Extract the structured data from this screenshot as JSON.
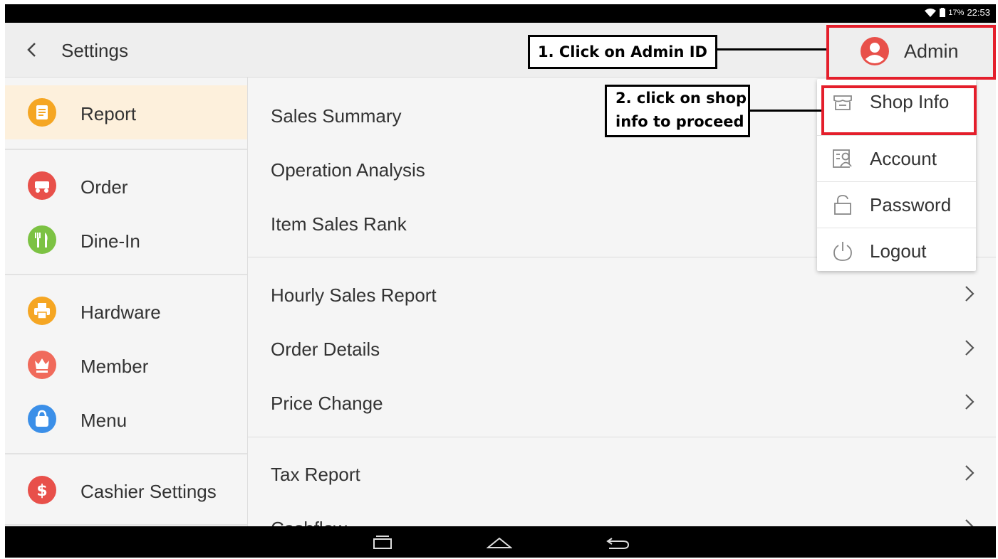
{
  "status_bar": {
    "battery": "17%",
    "time": "22:53"
  },
  "header": {
    "title": "Settings",
    "user": "Admin"
  },
  "sidebar": {
    "items": [
      {
        "label": "Report",
        "icon": "report-icon",
        "color": "#f5a623",
        "active": true
      },
      {
        "label": "Order",
        "icon": "order-icon",
        "color": "#e8504a"
      },
      {
        "label": "Dine-In",
        "icon": "fork-knife-icon",
        "color": "#7cc243"
      },
      {
        "label": "Hardware",
        "icon": "printer-icon",
        "color": "#f5a623"
      },
      {
        "label": "Member",
        "icon": "crown-icon",
        "color": "#f06a5b"
      },
      {
        "label": "Menu",
        "icon": "bag-icon",
        "color": "#3b8fe8"
      },
      {
        "label": "Cashier Settings",
        "icon": "dollar-icon",
        "color": "#e8504a"
      }
    ]
  },
  "main": {
    "items": [
      {
        "label": "Sales Summary",
        "chevron": false
      },
      {
        "label": "Operation Analysis",
        "chevron": false
      },
      {
        "label": "Item Sales Rank",
        "chevron": false
      },
      {
        "label": "Hourly Sales Report",
        "chevron": true
      },
      {
        "label": "Order Details",
        "chevron": true
      },
      {
        "label": "Price Change",
        "chevron": true
      },
      {
        "label": "Tax Report",
        "chevron": true
      },
      {
        "label": "Cashflow",
        "chevron": true
      }
    ]
  },
  "dropdown": {
    "items": [
      {
        "label": "Shop Info",
        "icon": "shop-icon"
      },
      {
        "label": "Account",
        "icon": "account-icon"
      },
      {
        "label": "Password",
        "icon": "lock-icon"
      },
      {
        "label": "Logout",
        "icon": "power-icon"
      }
    ]
  },
  "annotations": {
    "step1": "1. Click on Admin ID",
    "step2_line1": "2. click on shop",
    "step2_line2": "info to proceed",
    "highlight_color": "#e41e2b"
  }
}
